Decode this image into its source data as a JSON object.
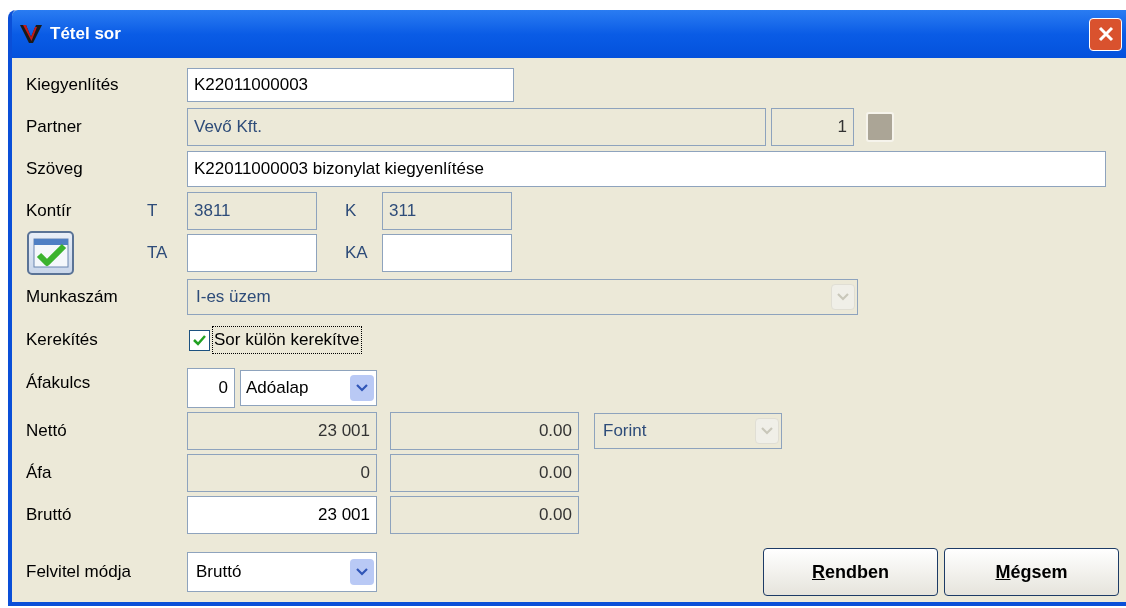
{
  "window": {
    "title": "Tétel sor"
  },
  "kiegyenlites": {
    "label": "Kiegyenlítés",
    "value": "K22011000003"
  },
  "partner": {
    "label": "Partner",
    "name": "Vevő Kft.",
    "number": "1"
  },
  "szoveg": {
    "label": "Szöveg",
    "value": "K22011000003 bizonylat kiegyenlítése"
  },
  "kontir": {
    "label": "Kontír",
    "fields": [
      {
        "label": "T",
        "value": "3811",
        "editable": false
      },
      {
        "label": "K",
        "value": "311",
        "editable": false
      },
      {
        "label": "TA",
        "editable": true
      },
      {
        "label": "KA",
        "editable": true
      }
    ]
  },
  "munkaszam": {
    "label": "Munkaszám",
    "value": "I-es üzem",
    "disabled": true
  },
  "kerekites": {
    "label": "Kerekítés",
    "checkbox": {
      "label": "Sor külön kerekítve",
      "checked": true,
      "focused": true
    }
  },
  "afakulcs": {
    "label": "Áfakulcs",
    "rate": "0",
    "base": "Adóalap"
  },
  "amounts": [
    {
      "label": "Nettó",
      "value": "23 001",
      "editable": false,
      "foreign": "0.00"
    },
    {
      "label": "Áfa",
      "value": "0",
      "editable": false,
      "foreign": "0.00"
    },
    {
      "label": "Bruttó",
      "value": "23 001",
      "editable": true,
      "foreign": "0.00"
    }
  ],
  "currency": {
    "value": "Forint",
    "disabled": true
  },
  "entry_mode": {
    "label": "Felvitel módja",
    "value": "Bruttó",
    "disabled": false
  },
  "buttons": [
    {
      "label": "Rendben",
      "mnemonic": true
    },
    {
      "label": "Mégsem",
      "mnemonic": true
    }
  ]
}
